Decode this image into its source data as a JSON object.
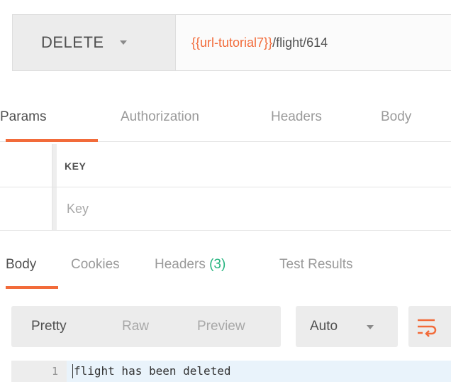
{
  "request": {
    "method": "DELETE",
    "url_variable": "{{url-tutorial7}}",
    "url_path": "/flight/614"
  },
  "request_tabs": [
    {
      "label": "Params",
      "active": true
    },
    {
      "label": "Authorization",
      "active": false
    },
    {
      "label": "Headers",
      "active": false
    },
    {
      "label": "Body",
      "active": false
    }
  ],
  "params": {
    "header_key": "KEY",
    "key_placeholder": "Key"
  },
  "response_tabs": [
    {
      "label": "Body",
      "active": true
    },
    {
      "label": "Cookies",
      "active": false
    },
    {
      "label": "Headers",
      "count": "(3)",
      "active": false
    },
    {
      "label": "Test Results",
      "active": false
    }
  ],
  "response_toolbar": {
    "views": [
      "Pretty",
      "Raw",
      "Preview"
    ],
    "active_view": "Pretty",
    "format": "Auto",
    "wrap_icon": "wrap-lines-icon"
  },
  "response_body": {
    "lines": [
      {
        "number": "1",
        "text": "flight has been deleted"
      }
    ]
  },
  "colors": {
    "accent": "#f26b3a",
    "count_green": "#26b47f"
  }
}
